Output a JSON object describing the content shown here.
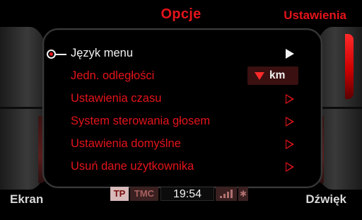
{
  "header": {
    "title": "Opcje",
    "right_label": "Ustawienia"
  },
  "menu": {
    "items": [
      {
        "label": "Język menu",
        "state": "selected",
        "control": "arrow-filled"
      },
      {
        "label": "Jedn. odległości",
        "state": "normal",
        "control": "value-badge",
        "value": "km"
      },
      {
        "label": "Ustawienia czasu",
        "state": "normal",
        "control": "arrow-outline"
      },
      {
        "label": "System sterowania głosem",
        "state": "normal",
        "control": "arrow-outline"
      },
      {
        "label": "Ustawienia domyślne",
        "state": "normal",
        "control": "arrow-outline"
      },
      {
        "label": "Usuń dane użytkownika",
        "state": "normal",
        "control": "arrow-outline"
      }
    ]
  },
  "footer": {
    "left_label": "Ekran",
    "right_label": "Dźwięk",
    "status": {
      "tp": "TP",
      "tmc": "TMC",
      "time": "19:54"
    }
  },
  "icons": [
    "cursor-ring-icon",
    "triangle-right-filled-icon",
    "triangle-right-outline-icon",
    "triangle-down-icon",
    "signal-bars-icon",
    "bluetooth-icon"
  ],
  "colors": {
    "accent": "#e4141b",
    "text_selected": "#f2f2f2",
    "background": "#000000"
  }
}
